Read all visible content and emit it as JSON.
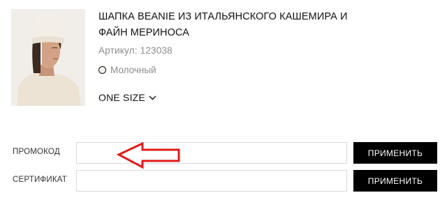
{
  "product": {
    "image_alt": "woman-in-beanie-photo",
    "title_line1": "ШАПКА BEANIE ИЗ ИТАЛЬЯНСКОГО КАШЕМИРА И",
    "title_line2": "ФАЙН МЕРИНОСА",
    "sku": "Артикул: 123038",
    "color": "Молочный",
    "size": "ONE SIZE",
    "size_icon": "chevron-down-icon"
  },
  "promo": {
    "label": "ПРОМОКОД",
    "value": "",
    "button": "ПРИМЕНИТЬ"
  },
  "certificate": {
    "label": "СЕРТИФИКАТ",
    "value": "",
    "button": "ПРИМЕНИТЬ"
  },
  "annotation": {
    "icon": "arrow-left-icon",
    "color": "#e01b1b"
  },
  "colors": {
    "button_bg": "#000000",
    "button_text": "#ffffff",
    "muted_text": "#8c8c8c",
    "border": "#d8d8d8"
  }
}
